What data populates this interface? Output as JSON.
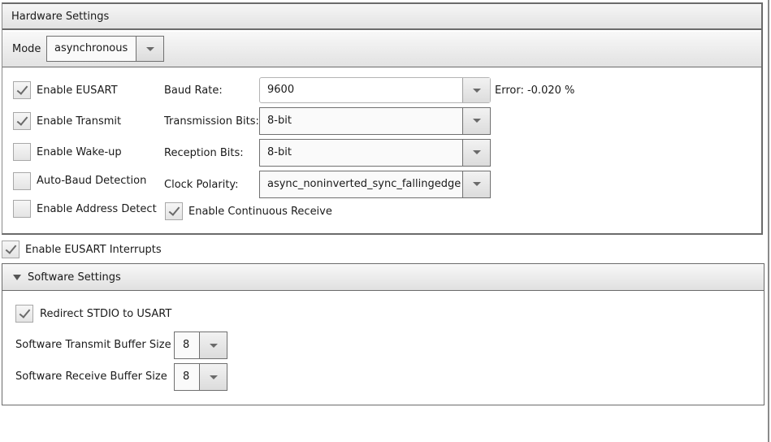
{
  "hardware": {
    "title": "Hardware Settings",
    "mode": {
      "label": "Mode",
      "value": "asynchronous"
    },
    "checkboxes": [
      {
        "label": "Enable EUSART",
        "checked": true
      },
      {
        "label": "Enable Transmit",
        "checked": true
      },
      {
        "label": "Enable Wake-up",
        "checked": false
      },
      {
        "label": "Auto-Baud Detection",
        "checked": false
      },
      {
        "label": "Enable Address Detect",
        "checked": false
      }
    ],
    "fields": {
      "baud_rate": {
        "label": "Baud Rate:",
        "value": "9600",
        "error": "Error: -0.020 %"
      },
      "transmission_bits": {
        "label": "Transmission Bits:",
        "value": "8-bit"
      },
      "reception_bits": {
        "label": "Reception Bits:",
        "value": "8-bit"
      },
      "clock_polarity": {
        "label": "Clock Polarity:",
        "value": "async_noninverted_sync_fallingedge"
      }
    },
    "continuous_receive": {
      "label": "Enable Continuous Receive",
      "checked": true
    }
  },
  "interrupts": {
    "label": "Enable EUSART Interrupts",
    "checked": true
  },
  "software": {
    "title": "Software Settings",
    "expanded": true,
    "redirect_stdio": {
      "label": "Redirect STDIO to USART",
      "checked": true
    },
    "transmit_buffer": {
      "label": "Software Transmit Buffer Size",
      "value": "8"
    },
    "receive_buffer": {
      "label": "Software Receive Buffer Size",
      "value": "8"
    }
  }
}
